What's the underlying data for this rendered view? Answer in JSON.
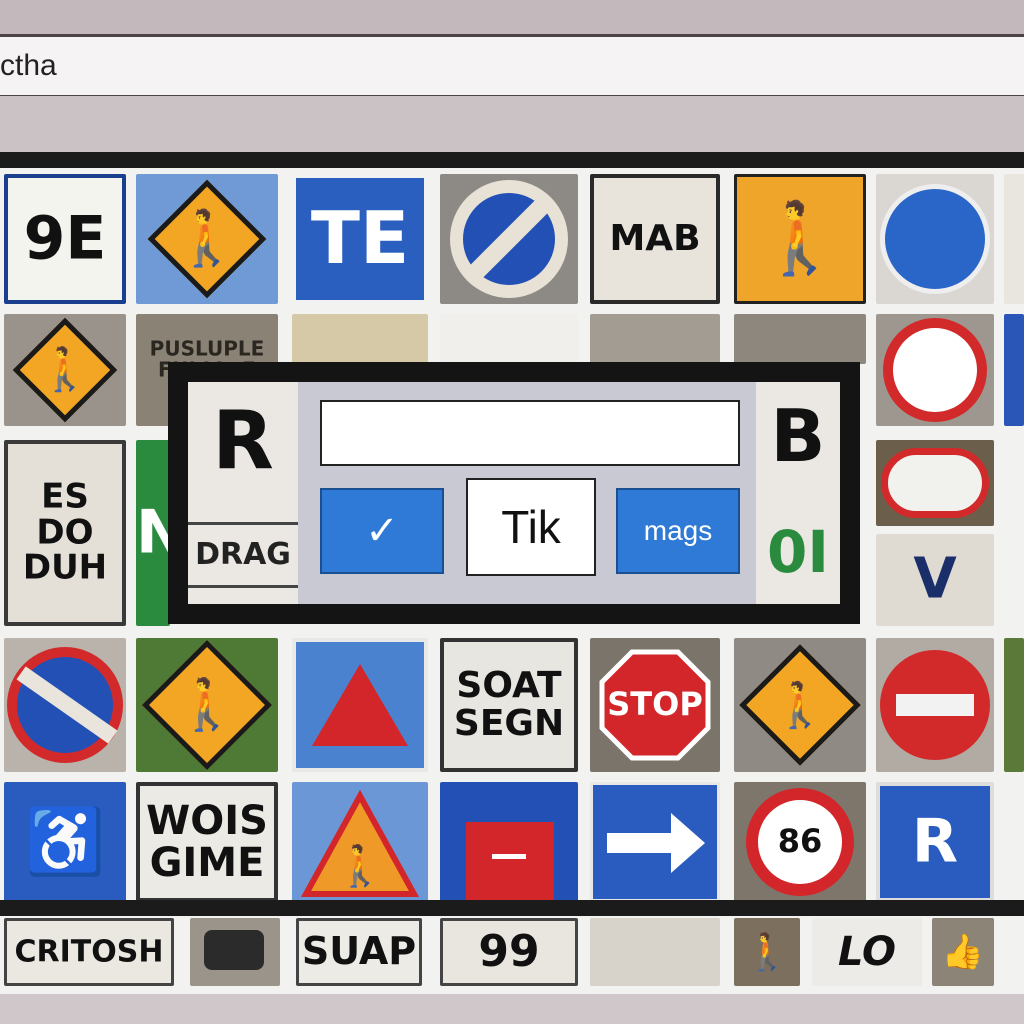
{
  "browser": {
    "address_text": "ctha"
  },
  "grid": {
    "row1": [
      "9E",
      "TE",
      "MAB"
    ],
    "row2": [
      "PUSLUPLE\nFNI LL  E\nC"
    ],
    "row3": [
      "ES\nDO\nDUH",
      "N"
    ],
    "row4": [
      "SOAT\nSEGN",
      "STOP"
    ],
    "row5": [
      "WOIS\nGIME",
      "86",
      "R"
    ],
    "row6": [
      "CRITOSH",
      "SUAP",
      "99",
      "LO"
    ]
  },
  "captcha": {
    "input_value": "",
    "left_labels": [
      "R",
      "DRAG"
    ],
    "right_labels": [
      "B",
      "0I"
    ],
    "check_label": "✓",
    "tik_label": "Tik",
    "mags_label": "mags"
  },
  "colors": {
    "sign_yellow": "#f2a623",
    "sign_blue": "#2f5fc4",
    "sign_red": "#d3262a",
    "button_blue": "#2e7ad6"
  },
  "icons": [
    "pedestrian-icon",
    "wheelchair-icon",
    "arrow-right-icon",
    "checkmark-icon"
  ]
}
